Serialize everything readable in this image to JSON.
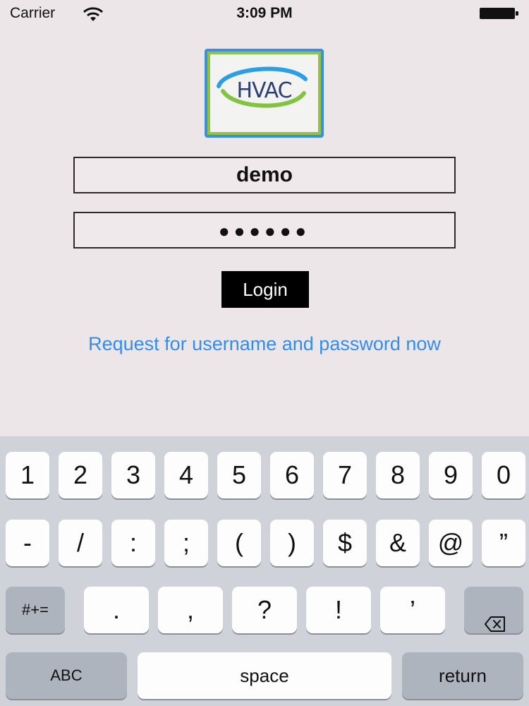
{
  "status_bar": {
    "carrier": "Carrier",
    "time": "3:09 PM"
  },
  "logo": {
    "text": "HVAC"
  },
  "login_form": {
    "username_value": "demo",
    "password_value": "●●●●●●",
    "login_label": "Login",
    "request_link_label": "Request for username and password now"
  },
  "keyboard": {
    "number_row": [
      "1",
      "2",
      "3",
      "4",
      "5",
      "6",
      "7",
      "8",
      "9",
      "0"
    ],
    "symbol_row": [
      "-",
      "/",
      ":",
      ";",
      "(",
      ")",
      "$",
      "&",
      "@",
      "”"
    ],
    "punctuation_row": [
      ".",
      ",",
      "?",
      "!",
      "’"
    ],
    "mode_label": "#+=",
    "abc_label": "ABC",
    "space_label": "space",
    "return_label": "return"
  },
  "colors": {
    "background": "#ede6e9",
    "link": "#2f8ef0",
    "logo_border": "#3b8ee0",
    "logo_accent": "#8ec43f",
    "keyboard_bg": "#cfd3d9"
  }
}
